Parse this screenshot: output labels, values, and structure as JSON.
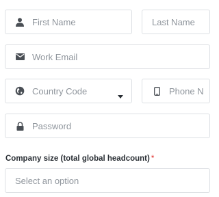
{
  "form": {
    "first_name": {
      "placeholder": "First Name",
      "icon": "user-icon"
    },
    "last_name": {
      "placeholder": "Last Name"
    },
    "work_email": {
      "placeholder": "Work Email",
      "icon": "envelope-icon"
    },
    "country_code": {
      "placeholder": "Country Code",
      "icon": "globe-icon"
    },
    "phone": {
      "placeholder": "Phone N",
      "icon": "phone-icon"
    },
    "password": {
      "placeholder": "Password",
      "icon": "lock-icon"
    },
    "company_size": {
      "label": "Company size (total global headcount)",
      "required_mark": "*",
      "placeholder": "Select an option"
    }
  },
  "colors": {
    "icon": "#4a4f55",
    "placeholder": "#8f959c",
    "border": "#dcdfe3",
    "required": "#e0332f"
  }
}
